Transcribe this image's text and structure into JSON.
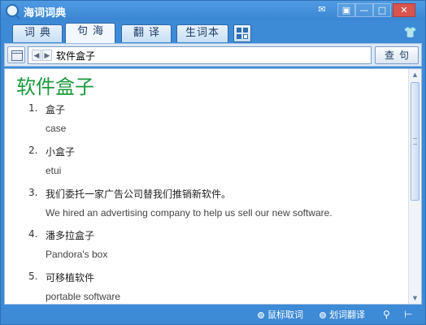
{
  "app": {
    "title": "海词词典",
    "colors": {
      "chrome": "#3d8ad6",
      "headword": "#1a9a3c"
    }
  },
  "window_controls": {
    "chat_icon": "chat-bubble-icon",
    "menu_icon": "menu-icon",
    "minimize_icon": "minimize-icon",
    "maximize_icon": "maximize-icon",
    "close_icon": "close-icon"
  },
  "tabs": [
    {
      "label": "词典",
      "active": false
    },
    {
      "label": "句海",
      "active": true
    },
    {
      "label": "翻译",
      "active": false
    },
    {
      "label": "生词本",
      "active": false
    }
  ],
  "toolbar": {
    "calendar_icon": "calendar-icon",
    "search_value": "软件盒子",
    "search_button": "查句"
  },
  "content": {
    "headword": "软件盒子",
    "definitions": [
      {
        "num": "1.",
        "zh": "盒子",
        "en": "case"
      },
      {
        "num": "2.",
        "zh": "小盒子",
        "en": "etui"
      },
      {
        "num": "3.",
        "zh": "我们委托一家广告公司替我们推销新软件。",
        "en": "We hired an advertising company to help us sell our new software."
      },
      {
        "num": "4.",
        "zh": "潘多拉盒子",
        "en": "Pandora's box"
      },
      {
        "num": "5.",
        "zh": "可移植软件",
        "en": "portable software"
      }
    ]
  },
  "statusbar": {
    "mouse_lookup": "鼠标取词",
    "select_translate": "划词翻译"
  }
}
